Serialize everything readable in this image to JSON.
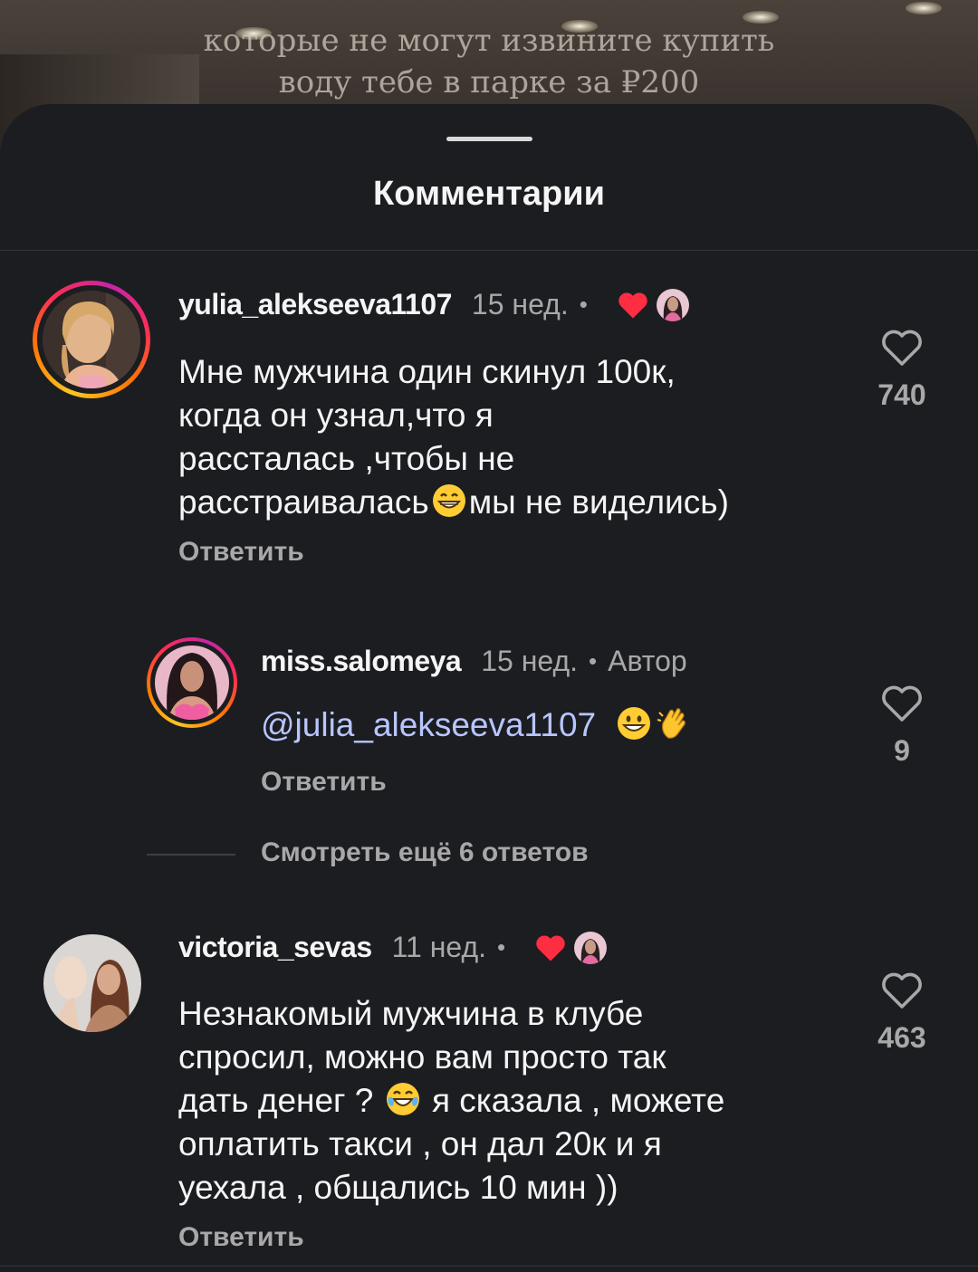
{
  "video": {
    "caption_line1": "которые не могут извините купить",
    "caption_line2": "воду тебе в парке за ₽200"
  },
  "sheet": {
    "title": "Комментарии"
  },
  "comments": [
    {
      "username": "yulia_alekseeva1107",
      "time": "15 нед.",
      "liked_by_author": true,
      "text_lines": [
        "Мне мужчина один скинул 100к,",
        "когда он узнал,что я",
        "рассталась ,чтобы не",
        "расстраивалась",
        "мы не виделись)"
      ],
      "emoji": "grinning-face-with-smiling-eyes",
      "reply_label": "Ответить",
      "like_count": "740"
    },
    {
      "username": "miss.salomeya",
      "time": "15 нед.",
      "author_label": "Автор",
      "mention": "@julia_alekseeva1107",
      "emojis": [
        "grinning-face",
        "clapping-hands"
      ],
      "reply_label": "Ответить",
      "like_count": "9"
    },
    {
      "username": "victoria_sevas",
      "time": "11 нед.",
      "liked_by_author": true,
      "text_lines": [
        "Незнакомый мужчина в клубе",
        "спросил, можно вам просто так",
        "дать денег ? ",
        " я сказала , можете",
        "оплатить такси , он дал 20к и я",
        "уехала , общались 10 мин ))"
      ],
      "emoji": "face-with-tears-of-joy",
      "reply_label": "Ответить",
      "like_count": "463"
    }
  ],
  "view_more": "Смотреть ещё 6 ответов",
  "colors": {
    "sheet_bg": "#1c1d21",
    "heart_red": "#ff2d42",
    "mention_blue": "#b8c6ff",
    "secondary_text": "#a8a8a8"
  }
}
